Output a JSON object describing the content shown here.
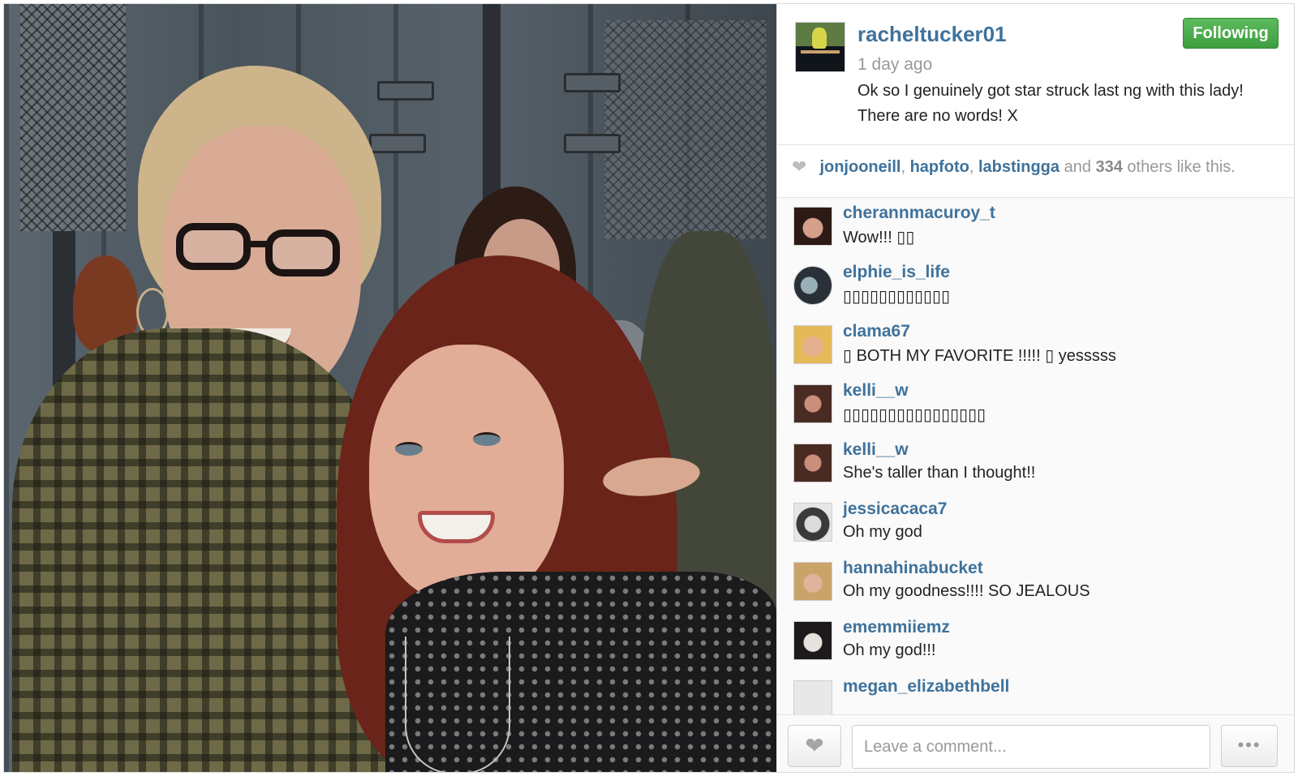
{
  "post": {
    "username": "racheltucker01",
    "time": "1 day ago",
    "caption": "Ok so I genuinely got star struck last ng with this lady! There are no words! X",
    "follow_label": "Following",
    "follow_color": "#4cae4c"
  },
  "likes": {
    "icon": "heart-icon",
    "likers": [
      "jonjooneill",
      "hapfoto",
      "labstingga"
    ],
    "sep": ", ",
    "and": " and ",
    "count": "334",
    "suffix": " others like this."
  },
  "comments": [
    {
      "user": "cherannmacuroy_t",
      "text": "Wow!!! ▯▯"
    },
    {
      "user": "elphie_is_life",
      "text": "▯▯▯▯▯▯▯▯▯▯▯▯"
    },
    {
      "user": "clama67",
      "text": "▯ BOTH MY FAVORITE !!!!! ▯ yesssss"
    },
    {
      "user": "kelli__w",
      "text": "▯▯▯▯▯▯▯▯▯▯▯▯▯▯▯▯"
    },
    {
      "user": "kelli__w",
      "text": "She's taller than I thought!!"
    },
    {
      "user": "jessicacaca7",
      "text": "Oh my god"
    },
    {
      "user": "hannahinabucket",
      "text": "Oh my goodness!!!! SO JEALOUS"
    },
    {
      "user": "ememmiiemz",
      "text": "Oh my god!!!"
    },
    {
      "user": "megan_elizabethbell",
      "text": ""
    }
  ],
  "comment_box": {
    "placeholder": "Leave a comment...",
    "more_label": "•••"
  },
  "colors": {
    "link": "#3f729b",
    "follow_green": "#4cae4c",
    "muted": "#999999"
  }
}
